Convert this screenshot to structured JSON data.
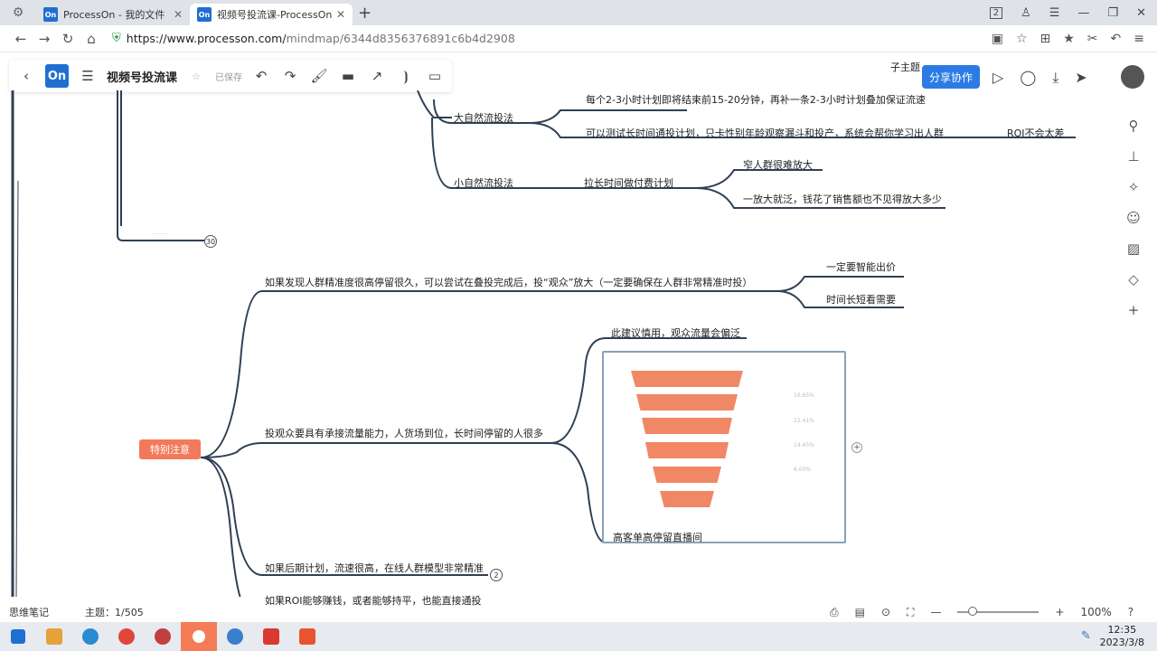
{
  "browser": {
    "tabs": [
      {
        "title": "ProcessOn - 我的文件",
        "favicon": "On"
      },
      {
        "title": "视频号投流课-ProcessOn",
        "favicon": "On"
      }
    ],
    "url_prefix": "https://www.processon.com/",
    "url_path": "mindmap/6344d8356376891c6b4d2908",
    "window_count": "2"
  },
  "app": {
    "logo": "On",
    "doc_title": "视频号投流课",
    "saved": "已保存",
    "share_label": "分享协作",
    "top_right_node": "子主题"
  },
  "map": {
    "nodes": {
      "big_natural": "大自然流投法",
      "big_child1": "每个2-3小时计划即将结束前15-20分钟，再补一条2-3小时计划叠加保证流速",
      "big_child2": "可以测试长时间通投计划，只卡性别年龄观察漏斗和投产，系统会帮你学习出人群",
      "roi_note": "ROI不会太差",
      "small_natural": "小自然流投法",
      "small_child": "拉长时间做付费计划",
      "small_leaf1": "窄人群很难放大",
      "small_leaf2": "一放大就泛，钱花了销售额也不见得放大多少",
      "collapsed_count_1": "30",
      "faint_label": "......",
      "special": "特别注意",
      "branch1": "如果发现人群精准度很高停留很久，可以尝试在叠投完成后，投“观众”放大（一定要确保在人群非常精准时投）",
      "branch1_leaf1": "一定要智能出价",
      "branch1_leaf2": "时间长短看需要",
      "branch2": "投观众要具有承接流量能力，人货场到位，长时间停留的人很多",
      "branch2_leaf1": "此建议慎用，观众流量会偏泛",
      "image_caption": "高客单高停留直播间",
      "branch3": "如果后期计划，流速很高，在线人群模型非常精准",
      "collapsed_count_2": "2",
      "branch4": "如果ROI能够赚钱，或者能够持平，也能直接通投"
    },
    "funnel_labels": [
      "16.65%",
      "22.41%",
      "14.45%",
      "6.00%",
      ""
    ]
  },
  "status": {
    "notes": "思维笔记",
    "topic_count": "主题：1/505",
    "zoom": "100%"
  },
  "taskbar": {
    "time": "12:35",
    "date": "2023/3/8"
  }
}
